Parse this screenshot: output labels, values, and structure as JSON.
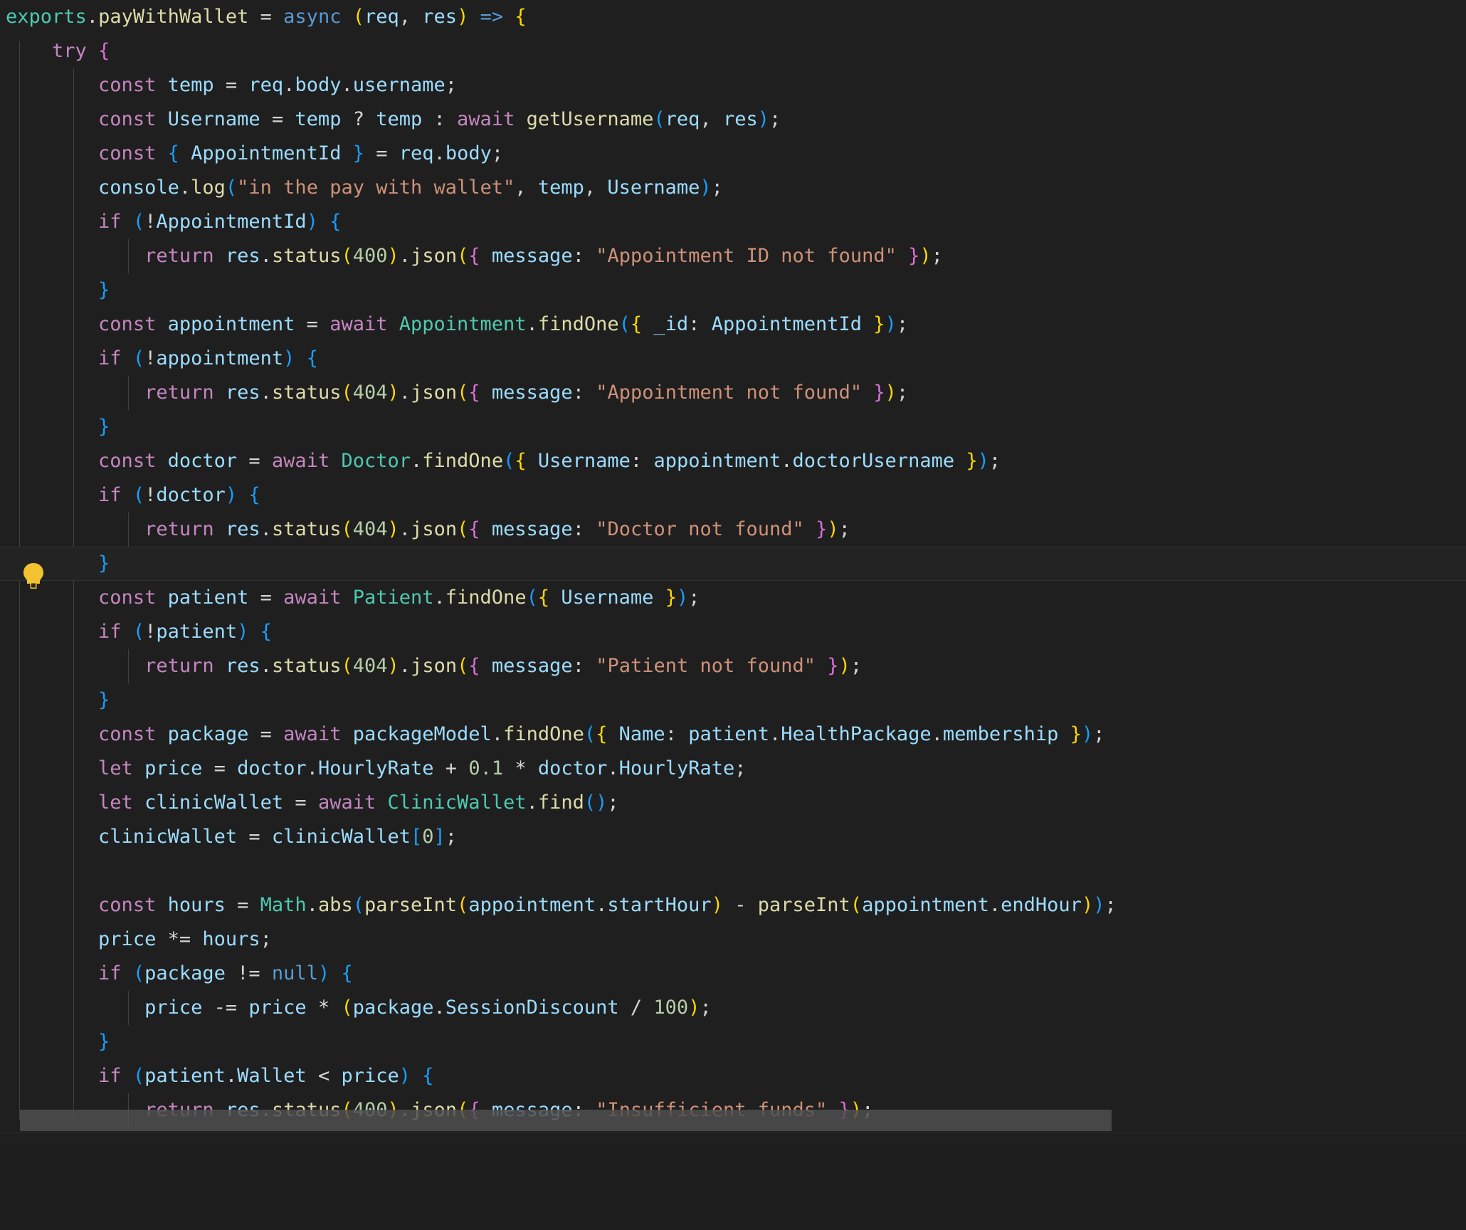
{
  "editor": {
    "language": "javascript",
    "theme": "Dark Modern",
    "background_color": "#1f1f1f",
    "current_line_index": 16,
    "gutter_icon": "lightbulb-icon",
    "gutter_icon_color": "#f2c231",
    "indent_guide_color": "#404040",
    "scrollbar": {
      "orientation": "horizontal",
      "color": "#4f4f4f"
    }
  },
  "colors": {
    "keyword": "#c586c0",
    "keyword_alt": "#569cd6",
    "variable": "#9cdcfe",
    "function": "#dcdcaa",
    "string": "#ce9178",
    "number": "#b5cea8",
    "type": "#4ec9b0",
    "punctuation": "#d4d4d4",
    "bracket_1": "#ffd700",
    "bracket_2": "#da70d6",
    "bracket_3": "#179fff"
  },
  "code": {
    "lines": [
      "exports.payWithWallet = async (req, res) => {",
      "    try {",
      "        const temp = req.body.username;",
      "        const Username = temp ? temp : await getUsername(req, res);",
      "        const { AppointmentId } = req.body;",
      "        console.log(\"in the pay with wallet\", temp, Username);",
      "        if (!AppointmentId) {",
      "            return res.status(400).json({ message: \"Appointment ID not found\" });",
      "        }",
      "        const appointment = await Appointment.findOne({ _id: AppointmentId });",
      "        if (!appointment) {",
      "            return res.status(404).json({ message: \"Appointment not found\" });",
      "        }",
      "        const doctor = await Doctor.findOne({ Username: appointment.doctorUsername });",
      "        if (!doctor) {",
      "            return res.status(404).json({ message: \"Doctor not found\" });",
      "        }",
      "        const patient = await Patient.findOne({ Username });",
      "        if (!patient) {",
      "            return res.status(404).json({ message: \"Patient not found\" });",
      "        }",
      "        const package = await packageModel.findOne({ Name: patient.HealthPackage.membership });",
      "        let price = doctor.HourlyRate + 0.1 * doctor.HourlyRate;",
      "        let clinicWallet = await ClinicWallet.find();",
      "        clinicWallet = clinicWallet[0];",
      "",
      "        const hours = Math.abs(parseInt(appointment.startHour) - parseInt(appointment.endHour));",
      "        price *= hours;",
      "        if (package != null) {",
      "            price -= price * (package.SessionDiscount / 100);",
      "        }",
      "        if (patient.Wallet < price) {",
      "            return res.status(400).json({ message: \"Insufficient funds\" });"
    ],
    "function_name": "payWithWallet",
    "strings": [
      "in the pay with wallet",
      "Appointment ID not found",
      "Appointment not found",
      "Doctor not found",
      "Patient not found",
      "Insufficient funds"
    ],
    "status_codes": [
      400,
      404,
      404,
      404,
      400
    ],
    "numbers": [
      "400",
      "404",
      "404",
      "404",
      "0",
      "0.1",
      "100",
      "400"
    ]
  }
}
